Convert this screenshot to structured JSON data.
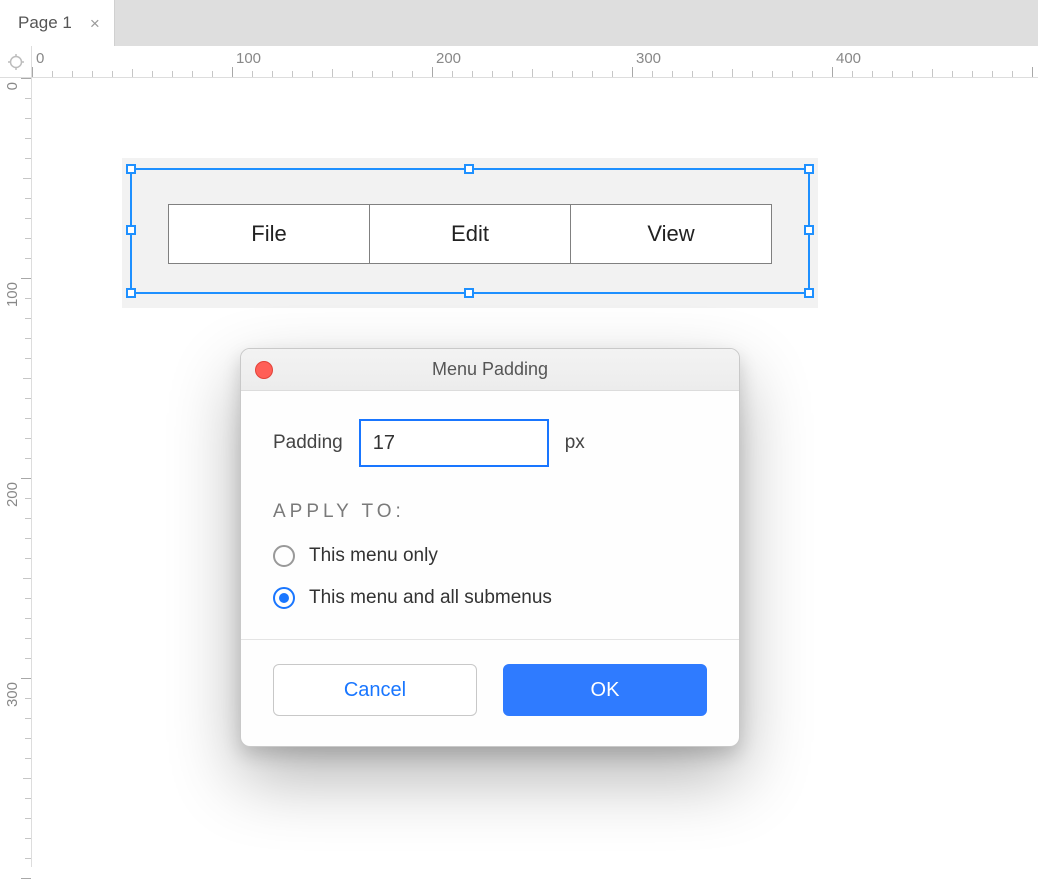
{
  "tab": {
    "label": "Page 1"
  },
  "ruler": {
    "horizontal_labels": [
      "0",
      "100",
      "200",
      "300",
      "400"
    ],
    "vertical_labels": [
      "0",
      "100",
      "200",
      "300"
    ]
  },
  "menu": {
    "items": [
      "File",
      "Edit",
      "View"
    ]
  },
  "dialog": {
    "title": "Menu Padding",
    "padding_label": "Padding",
    "padding_value": "17",
    "padding_unit": "px",
    "apply_heading": "APPLY TO:",
    "options": {
      "only": "This menu only",
      "all": "This menu and all submenus"
    },
    "selected_option": "all",
    "buttons": {
      "cancel": "Cancel",
      "ok": "OK"
    }
  }
}
